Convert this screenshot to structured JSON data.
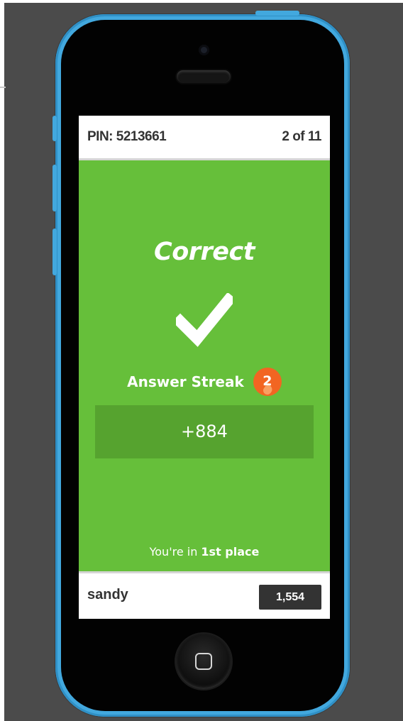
{
  "header": {
    "pin": "PIN: 5213661",
    "progress": "2 of 11"
  },
  "result": {
    "title": "Correct",
    "icon": "checkmark-icon"
  },
  "streak": {
    "label": "Answer Streak",
    "count": "2",
    "icon": "flame-icon"
  },
  "points": {
    "value": "+884"
  },
  "rank": {
    "prefix": "You're in",
    "place": "1st place"
  },
  "footer": {
    "player_name": "sandy",
    "score": "1,554"
  },
  "colors": {
    "correct_green": "#66bf3a",
    "points_box": "#56a32f",
    "streak_orange": "#f26522",
    "phone_blue": "#42a8de",
    "score_box": "#333333"
  }
}
